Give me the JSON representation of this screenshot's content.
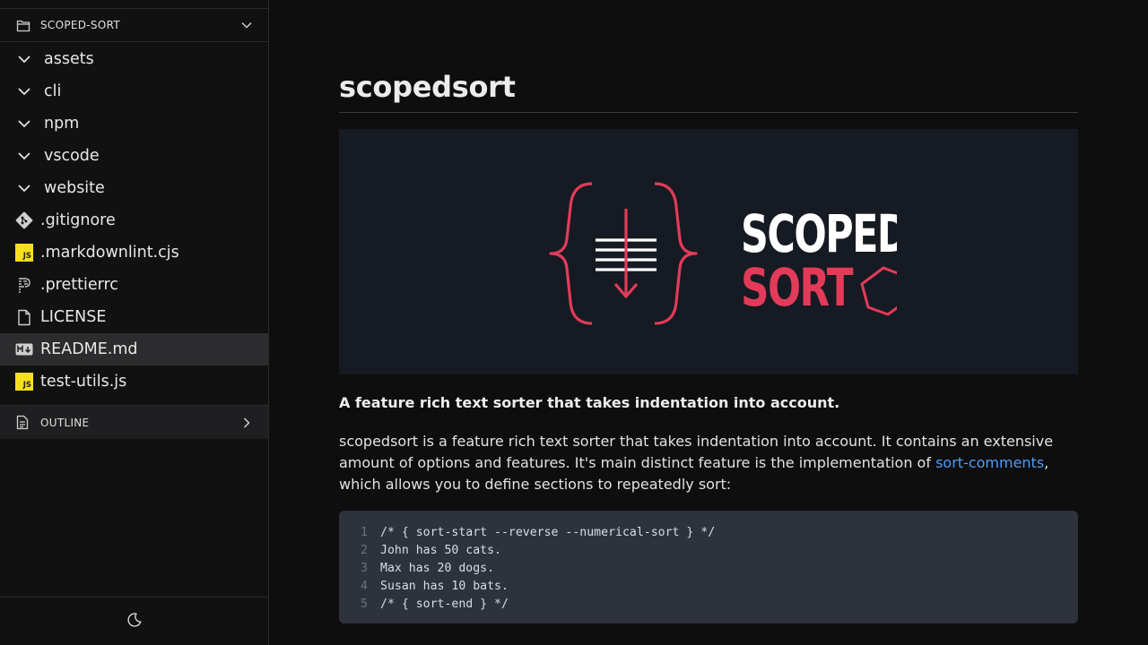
{
  "explorer": {
    "title": "SCOPED-SORT",
    "items": [
      {
        "label": "assets",
        "type": "folder"
      },
      {
        "label": "cli",
        "type": "folder"
      },
      {
        "label": "npm",
        "type": "folder"
      },
      {
        "label": "vscode",
        "type": "folder"
      },
      {
        "label": "website",
        "type": "folder"
      },
      {
        "label": ".gitignore",
        "type": "git"
      },
      {
        "label": ".markdownlint.cjs",
        "type": "js"
      },
      {
        "label": ".prettierrc",
        "type": "prettier"
      },
      {
        "label": "LICENSE",
        "type": "file"
      },
      {
        "label": "README.md",
        "type": "markdown",
        "selected": true
      },
      {
        "label": "test-utils.js",
        "type": "js"
      }
    ],
    "js_badge": "JS"
  },
  "outline": {
    "title": "OUTLINE"
  },
  "theme_toggle_icon": "moon-icon",
  "main": {
    "title": "scopedsort",
    "banner": {
      "line1": "SCOPED",
      "line2": "SORT",
      "accent": "#e23b5a",
      "bg": "#161a22"
    },
    "lead": "A feature rich text sorter that takes indentation into account.",
    "para_before": "scopedsort is a feature rich text sorter that takes indentation into account. It contains an extensive amount of options and features. It's main distinct feature is the implementation of ",
    "para_link": "sort-comments",
    "para_after": ", which allows you to define sections to repeatedly sort:",
    "code": [
      {
        "n": "1",
        "text": "/* { sort-start --reverse --numerical-sort } */"
      },
      {
        "n": "2",
        "text": "John has 50 cats."
      },
      {
        "n": "3",
        "text": "Max has 20 dogs."
      },
      {
        "n": "4",
        "text": "Susan has 10 bats."
      },
      {
        "n": "5",
        "text": "/* { sort-end } */"
      }
    ]
  },
  "colors": {
    "link": "#4e9cf5",
    "accent": "#e23b5a",
    "code_bg": "#2d323c",
    "selected_bg": "#2c2c2e"
  }
}
